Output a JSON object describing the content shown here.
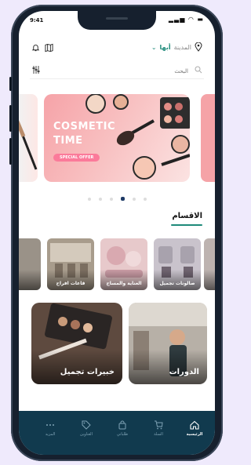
{
  "status_bar": {
    "time": "9:41",
    "icons": "▂▃▅ ◠ ▬"
  },
  "location": {
    "label": "المدينة",
    "value": "أبها"
  },
  "search": {
    "placeholder": "البحث"
  },
  "banner": {
    "title_line1": "COSMETIC",
    "title_line2": "TIME",
    "offer": "SPECIAL OFFER",
    "dot_count": 6,
    "active_dot": 3
  },
  "section": {
    "title": "الاقسام"
  },
  "categories": [
    {
      "label": "صالونات تجميل",
      "color": "#c9c3cc"
    },
    {
      "label": "العناية والمساج",
      "color": "#e7c9cb"
    },
    {
      "label": "قاعات افراح",
      "color": "#a89c8c"
    }
  ],
  "big_cards": [
    {
      "label": "الدورات",
      "color": "#b7b0a7"
    },
    {
      "label": "خبيرات تجميل",
      "color": "#5e4a3f"
    }
  ],
  "bottom_nav": [
    {
      "label": "الرئيسية",
      "icon": "home-icon",
      "active": true
    },
    {
      "label": "السلة",
      "icon": "cart-icon",
      "active": false
    },
    {
      "label": "طلباتي",
      "icon": "bag-icon",
      "active": false
    },
    {
      "label": "العناوين",
      "icon": "tag-icon",
      "active": false
    },
    {
      "label": "المزيد",
      "icon": "more-icon",
      "active": false
    }
  ],
  "colors": {
    "accent": "#1e8a7a",
    "nav_bg": "#113a4e",
    "banner_pink": "#f6a3a8"
  }
}
